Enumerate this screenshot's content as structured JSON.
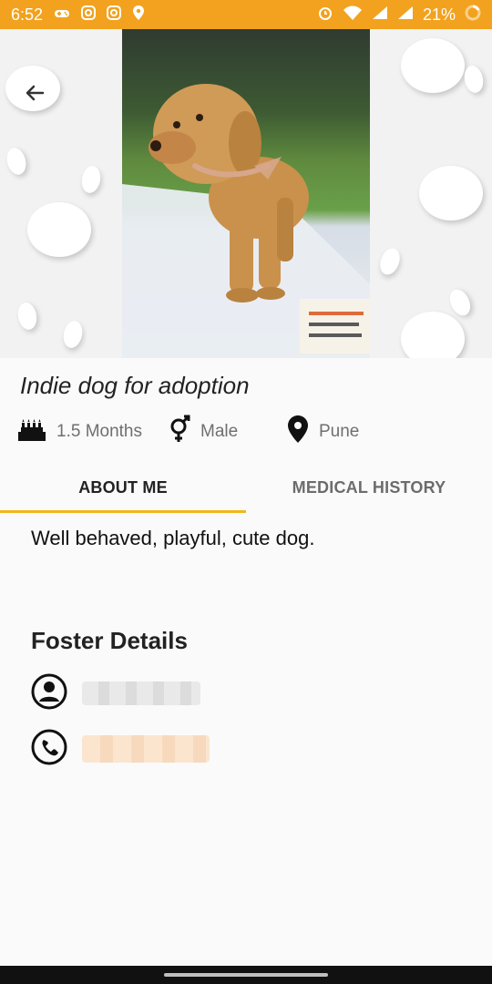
{
  "status_bar": {
    "time": "6:52",
    "battery": "21%",
    "icons_left": [
      "gamepad-icon",
      "instagram-icon",
      "instagram-icon",
      "location-pin-icon"
    ],
    "icons_right": [
      "alarm-icon",
      "wifi-icon",
      "signal-icon",
      "signal-icon",
      "battery-ring-icon"
    ]
  },
  "pet": {
    "title": "Indie dog for adoption",
    "age": "1.5 Months",
    "gender": "Male",
    "location": "Pune"
  },
  "tabs": [
    {
      "label": "ABOUT ME",
      "active": true
    },
    {
      "label": "MEDICAL HISTORY",
      "active": false
    }
  ],
  "about": {
    "text": "Well behaved, playful, cute dog."
  },
  "foster": {
    "title": "Foster Details"
  },
  "colors": {
    "accent": "#f2a21e",
    "tab_underline": "#f2b617",
    "text_dark": "#222222",
    "text_muted": "#6f6f6f"
  }
}
